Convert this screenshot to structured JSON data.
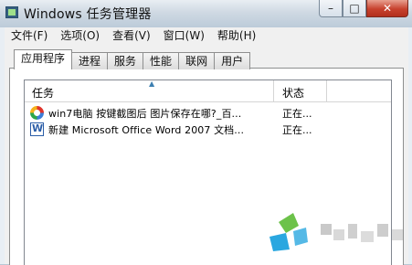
{
  "window": {
    "title": "Windows 任务管理器",
    "minimize": "–",
    "maximize": "□",
    "close": "✕"
  },
  "menu": [
    "文件(F)",
    "选项(O)",
    "查看(V)",
    "窗口(W)",
    "帮助(H)"
  ],
  "tabs": [
    "应用程序",
    "进程",
    "服务",
    "性能",
    "联网",
    "用户"
  ],
  "active_tab": "应用程序",
  "columns": {
    "task": "任务",
    "status": "状态",
    "sort_indicator": "▲"
  },
  "rows": [
    {
      "icon": "ie-icon",
      "task": "win7电脑 按键截图后 图片保存在哪?_百...",
      "status": "正在..."
    },
    {
      "icon": "word-icon",
      "task": "新建 Microsoft Office Word 2007 文档...",
      "status": "正在..."
    }
  ]
}
